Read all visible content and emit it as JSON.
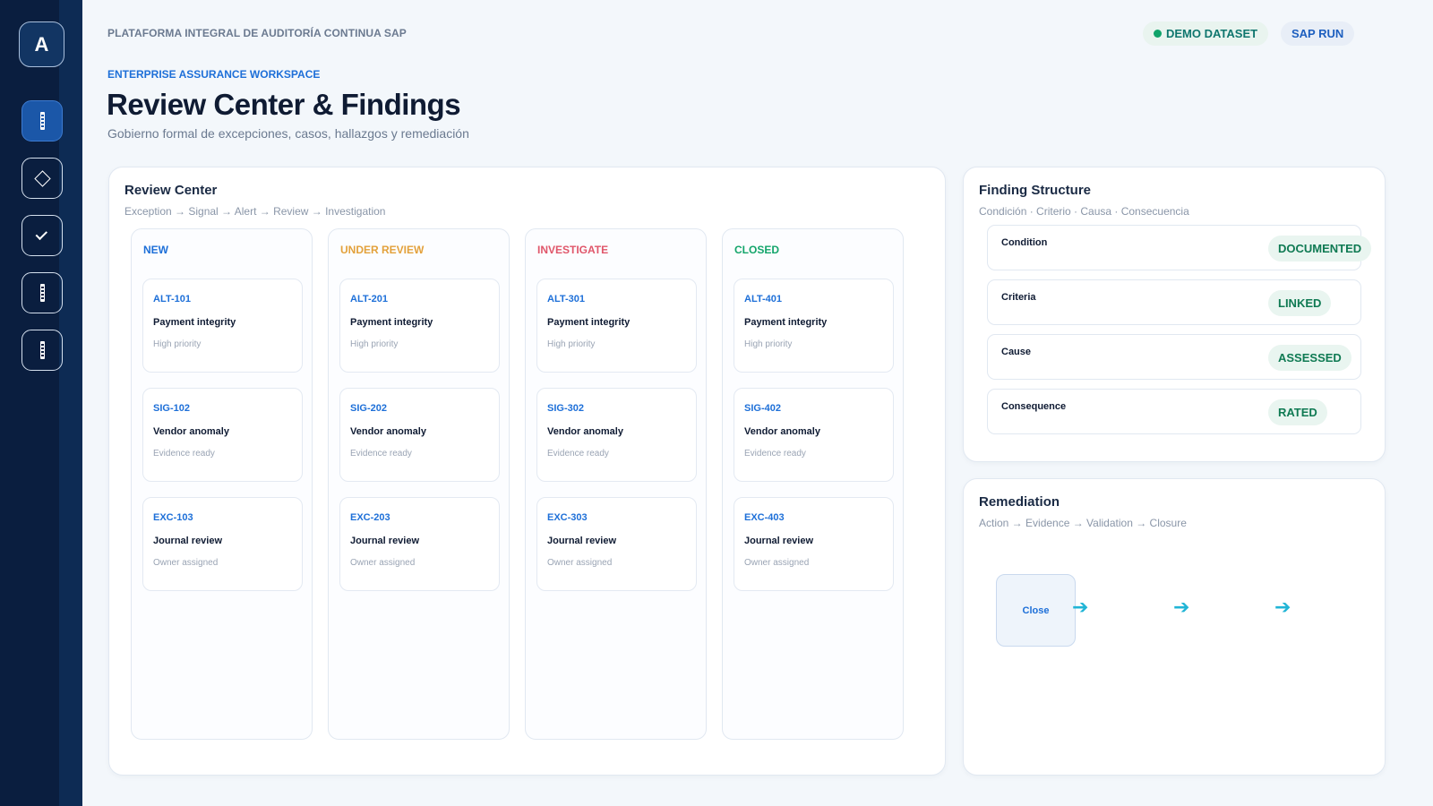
{
  "sidebar": {
    "logo": "A"
  },
  "header": {
    "platform": "PLATAFORMA INTEGRAL DE AUDITORÍA CONTINUA SAP",
    "demo_badge": "DEMO DATASET",
    "sap_badge": "SAP RUN",
    "eyebrow": "ENTERPRISE ASSURANCE WORKSPACE",
    "title": "Review Center & Findings",
    "subtitle": "Gobierno formal de excepciones, casos, hallazgos y remediación"
  },
  "review": {
    "title": "Review Center",
    "subtitle": "Exception → Signal → Alert → Review → Investigation",
    "columns": [
      {
        "label": "NEW",
        "color": "#1d6fd8",
        "cards": [
          {
            "id": "ALT-101",
            "title": "Payment integrity",
            "meta": "High priority"
          },
          {
            "id": "SIG-102",
            "title": "Vendor anomaly",
            "meta": "Evidence ready"
          },
          {
            "id": "EXC-103",
            "title": "Journal review",
            "meta": "Owner assigned"
          }
        ]
      },
      {
        "label": "UNDER REVIEW",
        "color": "#e3a13b",
        "cards": [
          {
            "id": "ALT-201",
            "title": "Payment integrity",
            "meta": "High priority"
          },
          {
            "id": "SIG-202",
            "title": "Vendor anomaly",
            "meta": "Evidence ready"
          },
          {
            "id": "EXC-203",
            "title": "Journal review",
            "meta": "Owner assigned"
          }
        ]
      },
      {
        "label": "INVESTIGATE",
        "color": "#e0566a",
        "cards": [
          {
            "id": "ALT-301",
            "title": "Payment integrity",
            "meta": "High priority"
          },
          {
            "id": "SIG-302",
            "title": "Vendor anomaly",
            "meta": "Evidence ready"
          },
          {
            "id": "EXC-303",
            "title": "Journal review",
            "meta": "Owner assigned"
          }
        ]
      },
      {
        "label": "CLOSED",
        "color": "#14a56b",
        "cards": [
          {
            "id": "ALT-401",
            "title": "Payment integrity",
            "meta": "High priority"
          },
          {
            "id": "SIG-402",
            "title": "Vendor anomaly",
            "meta": "Evidence ready"
          },
          {
            "id": "EXC-403",
            "title": "Journal review",
            "meta": "Owner assigned"
          }
        ]
      }
    ]
  },
  "finding": {
    "title": "Finding Structure",
    "subtitle": "Condición · Criterio · Causa · Consecuencia",
    "rows": [
      {
        "label": "Condition",
        "status": "DOCUMENTED"
      },
      {
        "label": "Criteria",
        "status": "LINKED"
      },
      {
        "label": "Cause",
        "status": "ASSESSED"
      },
      {
        "label": "Consequence",
        "status": "RATED"
      }
    ]
  },
  "remediation": {
    "title": "Remediation",
    "subtitle": "Action → Evidence → Validation → Closure",
    "step_label": "Close"
  }
}
